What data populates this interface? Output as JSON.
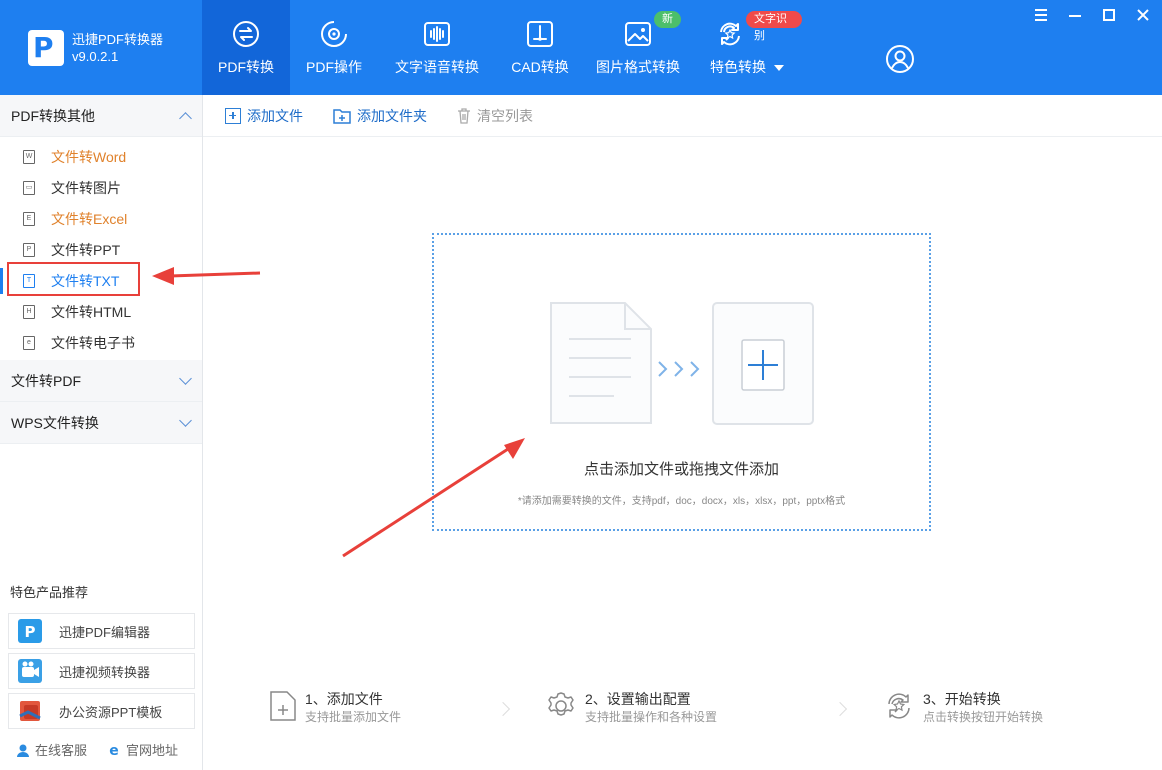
{
  "app": {
    "name": "迅捷PDF转换器",
    "version": "v9.0.2.1"
  },
  "tabs": [
    {
      "label": "PDF转换",
      "icon": "swap-circle-icon",
      "active": true
    },
    {
      "label": "PDF操作",
      "icon": "gear-circle-icon"
    },
    {
      "label": "文字语音转换",
      "icon": "audio-wave-icon"
    },
    {
      "label": "CAD转换",
      "icon": "cad-icon"
    },
    {
      "label": "图片格式转换",
      "icon": "image-icon",
      "badge": "新"
    },
    {
      "label": "特色转换",
      "icon": "star-refresh-icon",
      "badge": "文字识别"
    }
  ],
  "sidebar": {
    "section1": "PDF转换其他",
    "items": [
      {
        "label": "文件转Word",
        "icon_letter": "W"
      },
      {
        "label": "文件转图片",
        "icon_letter": "▭"
      },
      {
        "label": "文件转Excel",
        "icon_letter": "E"
      },
      {
        "label": "文件转PPT",
        "icon_letter": "P"
      },
      {
        "label": "文件转TXT",
        "icon_letter": "T"
      },
      {
        "label": "文件转HTML",
        "icon_letter": "H"
      },
      {
        "label": "文件转电子书",
        "icon_letter": "e"
      }
    ],
    "section2": "文件转PDF",
    "section3": "WPS文件转换",
    "promo_title": "特色产品推荐",
    "promos": [
      {
        "label": "迅捷PDF编辑器"
      },
      {
        "label": "迅捷视频转换器"
      },
      {
        "label": "办公资源PPT模板"
      }
    ],
    "links": {
      "service": "在线客服",
      "website": "官网地址"
    }
  },
  "toolbar": {
    "add_file": "添加文件",
    "add_folder": "添加文件夹",
    "clear_list": "清空列表"
  },
  "dropzone": {
    "title": "点击添加文件或拖拽文件添加",
    "subtitle": "*请添加需要转换的文件，支持pdf，doc，docx，xls，xlsx，ppt，pptx格式"
  },
  "steps": [
    {
      "title": "1、添加文件",
      "desc": "支持批量添加文件"
    },
    {
      "title": "2、设置输出配置",
      "desc": "支持批量操作和各种设置"
    },
    {
      "title": "3、开始转换",
      "desc": "点击转换按钮开始转换"
    }
  ],
  "colors": {
    "header_blue": "#1e7ff0",
    "active_tab": "#1266d9",
    "highlight_orange": "#e0822c",
    "annotation_red": "#e8403a"
  }
}
